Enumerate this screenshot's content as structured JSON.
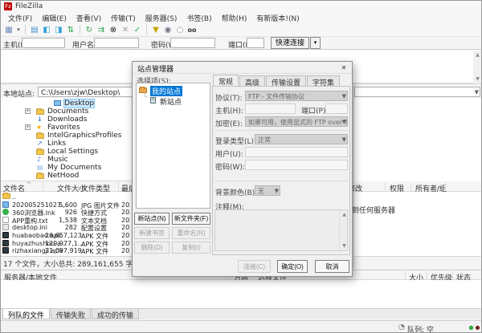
{
  "window": {
    "title": "FileZilla"
  },
  "menu": {
    "items": [
      "文件(F)",
      "编辑(E)",
      "查看(V)",
      "传输(T)",
      "服务器(S)",
      "书签(B)",
      "帮助(H)",
      "有新版本!(N)"
    ]
  },
  "toolbar": {
    "icons": [
      {
        "name": "site-manager",
        "glyph": "▦"
      },
      {
        "name": "toggle-log",
        "glyph": "▤"
      },
      {
        "name": "toggle-local-tree",
        "glyph": "◧"
      },
      {
        "name": "toggle-remote-tree",
        "glyph": "◨"
      },
      {
        "name": "toggle-queue",
        "glyph": "⇅"
      },
      {
        "name": "refresh",
        "glyph": "↻"
      },
      {
        "name": "process-queue",
        "glyph": "⇉"
      },
      {
        "name": "cancel",
        "glyph": "⊗"
      },
      {
        "name": "disconnect",
        "glyph": "✕"
      },
      {
        "name": "reconnect",
        "glyph": "✓"
      },
      {
        "name": "filter",
        "glyph": "▼"
      },
      {
        "name": "compare",
        "glyph": "◉"
      },
      {
        "name": "sync-browsing",
        "glyph": "○"
      },
      {
        "name": "find",
        "glyph": "oo"
      }
    ]
  },
  "quickconnect": {
    "host_label": "主机(H):",
    "username_label": "用户名(U):",
    "password_label": "密码(W):",
    "port_label": "端口(P):",
    "connect_label": "快速连接(Q)"
  },
  "local": {
    "bar_label": "本地站点:",
    "path": "C:\\Users\\zjw\\Desktop\\",
    "tree": [
      {
        "expand": "",
        "label": "Desktop",
        "selected": true
      },
      {
        "expand": "+",
        "label": "Documents"
      },
      {
        "expand": "",
        "label": "Downloads"
      },
      {
        "expand": "+",
        "label": "Favorites"
      },
      {
        "expand": "",
        "label": "IntelGraphicsProfiles"
      },
      {
        "expand": "",
        "label": "Links"
      },
      {
        "expand": "",
        "label": "Local Settings"
      },
      {
        "expand": "",
        "label": "Music"
      },
      {
        "expand": "",
        "label": "My Documents"
      },
      {
        "expand": "",
        "label": "NetHood"
      }
    ],
    "columns": [
      "文件名",
      "文件大小",
      "文件类型",
      "最后修改"
    ],
    "sort_indicator": "^",
    "files": [
      {
        "name": "..",
        "size": "",
        "type": "",
        "date": ""
      },
      {
        "name": "202005251027...",
        "size": "5,600",
        "type": "JPG 图片文件",
        "date": "20"
      },
      {
        "name": "360浏览器.lnk",
        "size": "926",
        "type": "快捷方式",
        "date": "20"
      },
      {
        "name": "APP重构.txt",
        "size": "1,538",
        "type": "文本文档",
        "date": "20"
      },
      {
        "name": "desktop.ini",
        "size": "282",
        "type": "配置设置",
        "date": "20"
      },
      {
        "name": "huabaobao.apk",
        "size": "26,657,123",
        "type": "APK 文件",
        "date": "20"
      },
      {
        "name": "huyazhushou.a...",
        "size": "129,977,1...",
        "type": "APK 文件",
        "date": "20"
      },
      {
        "name": "rizhaxiangji.apk",
        "size": "21,097,919",
        "type": "APK 文件",
        "date": "20"
      }
    ],
    "status": "17 个文件，大小总共: 289,161,655 字节"
  },
  "remote": {
    "columns": [
      "最后修改",
      "权限",
      "所有者/组"
    ],
    "not_connected": "未连接到任何服务器"
  },
  "queue": {
    "columns": [
      "服务器/本地文件",
      "方向",
      "远程文件",
      "大小",
      "优先级",
      "状态"
    ],
    "tabs": [
      "列队的文件",
      "传输失败",
      "成功的传输"
    ]
  },
  "statusbar": {
    "queue_text": "队列: 空"
  },
  "dialog": {
    "title": "站点管理器",
    "close_glyph": "✕",
    "select_label": "选择项(S):",
    "tree": {
      "root": "我的站点",
      "child": "新站点"
    },
    "tabs": [
      "常规",
      "高级",
      "传输设置",
      "字符集"
    ],
    "fields": {
      "protocol_label": "协议(T):",
      "protocol_value": "FTP - 文件传输协议",
      "host_label": "主机(H):",
      "port_label": "端口(P):",
      "encryption_label": "加密(E):",
      "encryption_value": "如果可用，使用显式的 FTP over TLS",
      "logon_label": "登录类型(L):",
      "logon_value": "正常",
      "user_label": "用户(U):",
      "password_label": "密码(W):",
      "bgcolor_label": "背景颜色(B):",
      "bgcolor_value": "无",
      "comments_label": "注释(M):"
    },
    "buttons": {
      "new_site": "新站点(N)",
      "new_folder": "新文件夹(F)",
      "new_bookmark": "新建书签(M)",
      "rename": "重命名(R)",
      "delete": "删除(D)",
      "duplicate": "复制(I)",
      "connect": "连接(C)",
      "ok": "确定(O)",
      "cancel": "取消"
    }
  },
  "colors": {
    "selection": "#0078d7",
    "accent_red": "#bf0000"
  }
}
